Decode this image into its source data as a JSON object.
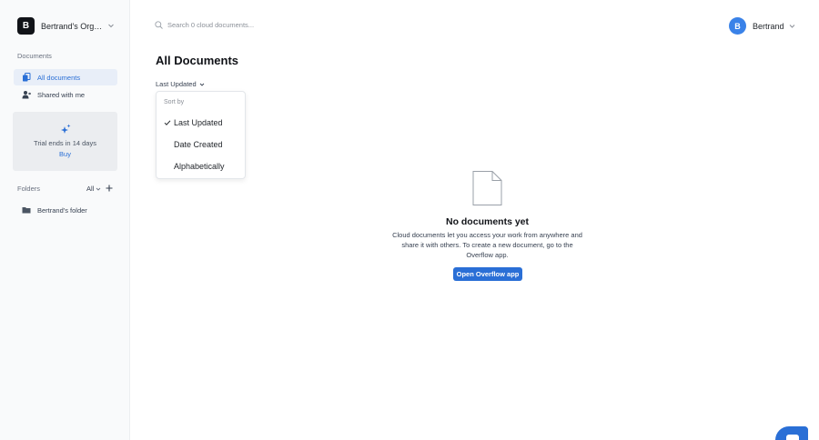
{
  "org": {
    "initial": "B",
    "name": "Bertrand's Organization"
  },
  "sidebar": {
    "documents_label": "Documents",
    "items": [
      {
        "label": "All documents",
        "icon": "documents-icon",
        "active": true
      },
      {
        "label": "Shared with me",
        "icon": "shared-user-icon",
        "active": false
      }
    ],
    "trial": {
      "text": "Trial ends in 14 days",
      "action": "Buy",
      "icon": "sparkle-icon"
    },
    "folders_label": "Folders",
    "folders_filter": "All",
    "folders": [
      {
        "label": "Bertrand's folder",
        "icon": "folder-icon"
      }
    ]
  },
  "search": {
    "placeholder": "Search 0 cloud documents..."
  },
  "user": {
    "initial": "B",
    "name": "Bertrand"
  },
  "main": {
    "title": "All Documents",
    "sort_current": "Last Updated",
    "sort_menu": {
      "label": "Sort by",
      "options": [
        {
          "label": "Last Updated",
          "selected": true
        },
        {
          "label": "Date Created",
          "selected": false
        },
        {
          "label": "Alphabetically",
          "selected": false
        }
      ]
    },
    "empty": {
      "title": "No documents yet",
      "description": "Cloud documents let you access your work from anywhere and share it with others. To create a new document, go to the Overflow app.",
      "button": "Open Overflow app"
    }
  },
  "colors": {
    "accent": "#2a6fd6",
    "sidebar_bg": "#f9fafb",
    "avatar": "#3a82e8"
  }
}
